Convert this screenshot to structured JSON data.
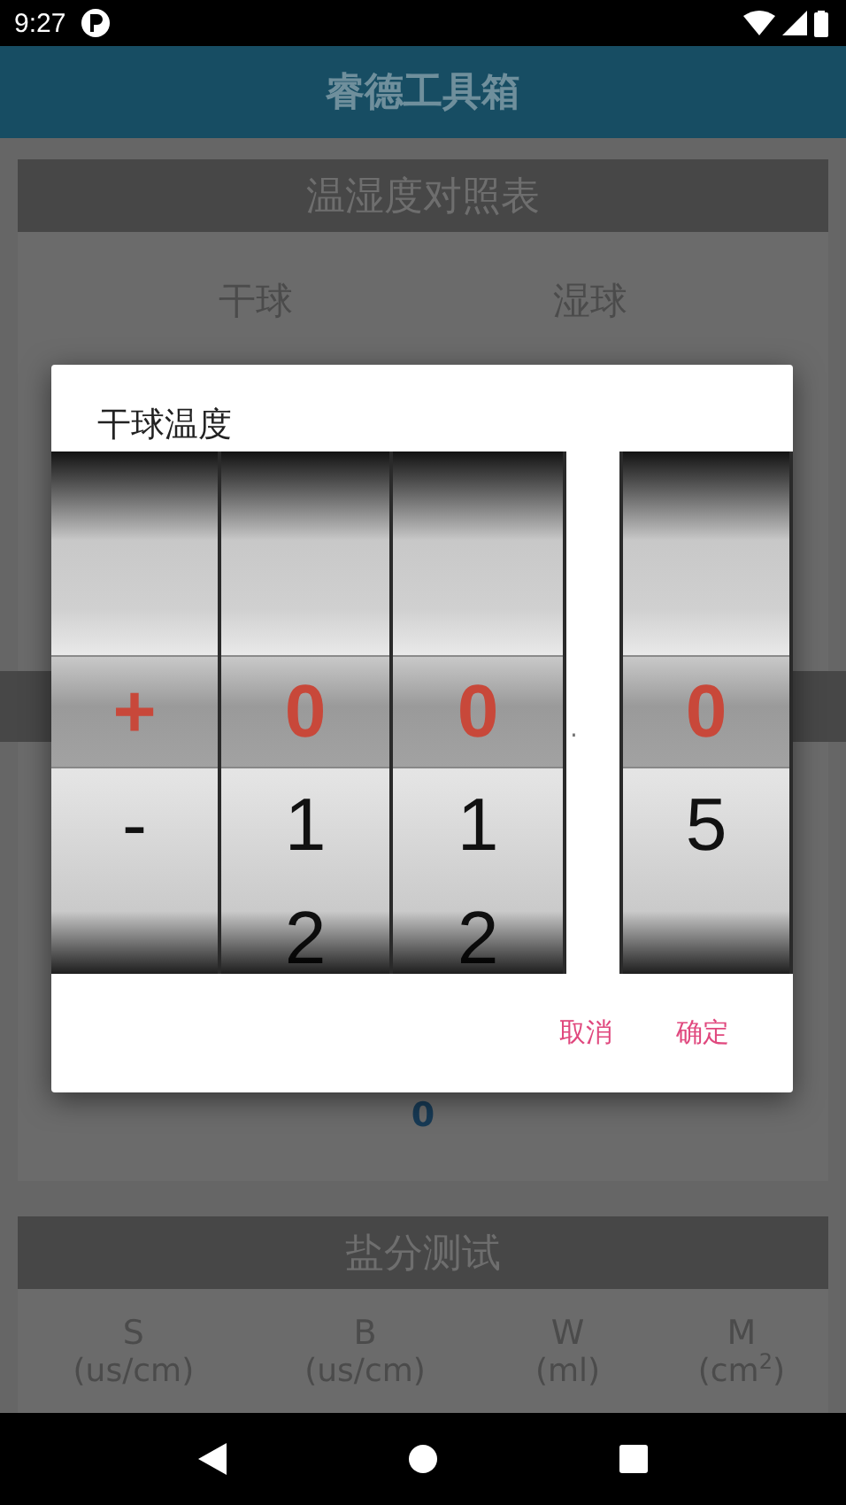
{
  "status_bar": {
    "time": "9:27"
  },
  "app_bar": {
    "title": "睿德工具箱"
  },
  "sections": [
    {
      "title": "温湿度对照表",
      "columns": [
        {
          "label": "干球"
        },
        {
          "label": "湿球"
        }
      ],
      "result": "0"
    },
    {
      "title": "盐分测试",
      "columns": [
        {
          "label": "S",
          "unit": "(us/cm)"
        },
        {
          "label": "B",
          "unit": "(us/cm)"
        },
        {
          "label": "W",
          "unit": "(ml)"
        },
        {
          "label": "M",
          "unit": "(cm$^{2}$)"
        }
      ]
    }
  ],
  "dialog": {
    "title": "干球温度",
    "wheels": [
      {
        "kind": "wheel",
        "items": [
          {
            "text": "+",
            "selected": true
          },
          {
            "text": "-",
            "selected": false
          }
        ]
      },
      {
        "kind": "wheel",
        "items": [
          {
            "text": "0",
            "selected": true
          },
          {
            "text": "1",
            "selected": false
          },
          {
            "text": "2",
            "selected": false
          }
        ]
      },
      {
        "kind": "wheel",
        "items": [
          {
            "text": "0",
            "selected": true
          },
          {
            "text": "1",
            "selected": false
          },
          {
            "text": "2",
            "selected": false
          }
        ]
      },
      {
        "kind": "separator",
        "text": "."
      },
      {
        "kind": "wheel",
        "items": [
          {
            "text": "0",
            "selected": true
          },
          {
            "text": "5",
            "selected": false
          }
        ]
      }
    ],
    "buttons": [
      "取消",
      "确定"
    ]
  }
}
